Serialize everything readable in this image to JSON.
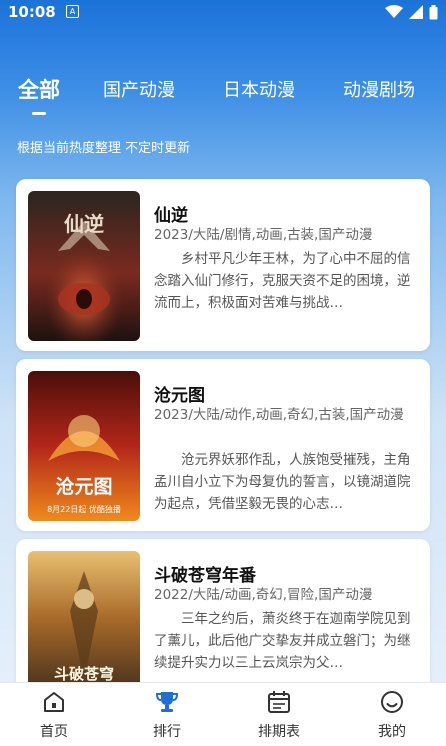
{
  "status_bar": {
    "time": "10:08",
    "notification_glyph": "A"
  },
  "tabs": [
    {
      "label": "全部",
      "active": true
    },
    {
      "label": "国产动漫",
      "active": false
    },
    {
      "label": "日本动漫",
      "active": false
    },
    {
      "label": "动漫剧场",
      "active": false
    }
  ],
  "subtitle": "根据当前热度整理 不定时更新",
  "items": [
    {
      "title": "仙逆",
      "meta": "2023/大陆/剧情,动画,古装,国产动漫",
      "description": "乡村平凡少年王林，为了心中不屈的信念踏入仙门修行，克服天资不足的困境，逆流而上，积极面对苦难与挑战…",
      "poster_text": "仙逆",
      "poster_colors": [
        "#2b2520",
        "#7a2a1e",
        "#c44a2a"
      ]
    },
    {
      "title": "沧元图",
      "meta": "2023/大陆/动作,动画,奇幻,古装,国产动漫",
      "description": "沧元界妖邪作乱，人族饱受摧残，主角孟川自小立下为母复仇的誓言，以镜湖道院为起点，凭借坚毅无畏的心志…",
      "poster_text": "沧元图",
      "poster_caption": "8月22日起 优酷独播",
      "poster_colors": [
        "#3a0d0a",
        "#b3261a",
        "#f08a1c"
      ]
    },
    {
      "title": "斗破苍穹年番",
      "meta": "2022/大陆/动画,奇幻,冒险,国产动漫",
      "description": "三年之约后，萧炎终于在迦南学院见到了薰儿，此后他广交挚友并成立磐门；为继续提升实力以三上云岚宗为父…",
      "poster_text": "斗破苍穹",
      "poster_colors": [
        "#3a2a1a",
        "#a86a2a",
        "#e8c070"
      ]
    }
  ],
  "bottom_nav": [
    {
      "label": "首页",
      "icon": "home-icon",
      "active": false
    },
    {
      "label": "排行",
      "icon": "trophy-icon",
      "active": true
    },
    {
      "label": "排期表",
      "icon": "calendar-icon",
      "active": false
    },
    {
      "label": "我的",
      "icon": "smiley-icon",
      "active": false
    }
  ],
  "colors": {
    "accent": "#1f6fd6",
    "header_blue": "#1b72d8"
  }
}
